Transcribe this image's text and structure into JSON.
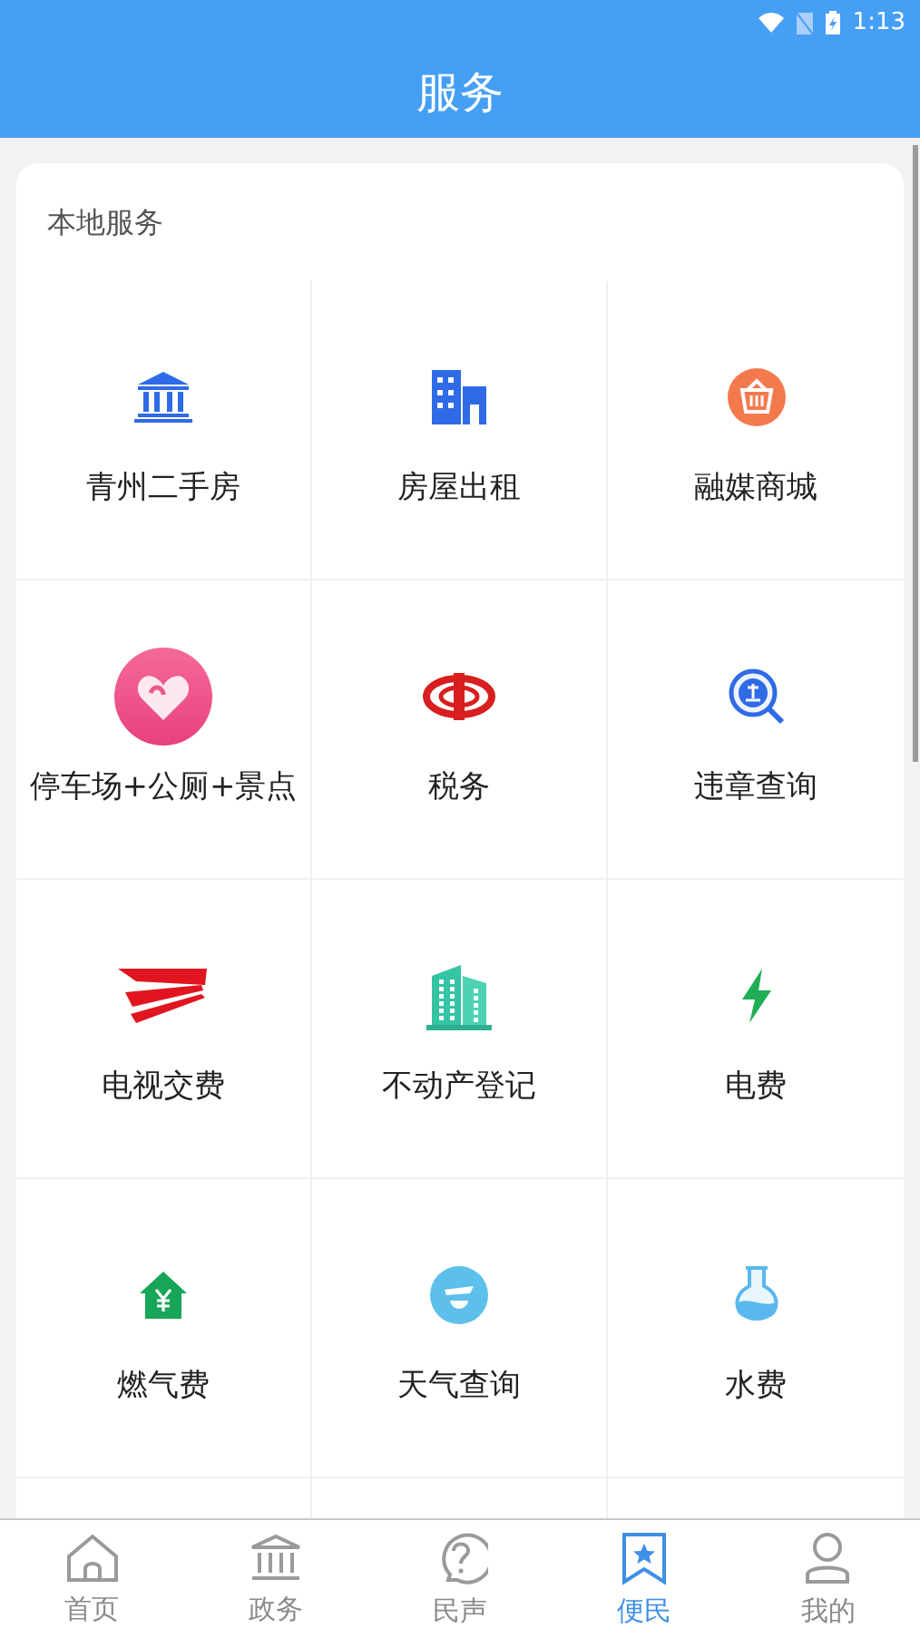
{
  "status_bar": {
    "time": "1:13"
  },
  "header": {
    "title": "服务"
  },
  "section": {
    "title": "本地服务",
    "items": [
      {
        "label": "青州二手房"
      },
      {
        "label": "房屋出租"
      },
      {
        "label": "融媒商城"
      },
      {
        "label": "停车场+公厕+景点"
      },
      {
        "label": "税务"
      },
      {
        "label": "违章查询"
      },
      {
        "label": "电视交费"
      },
      {
        "label": "不动产登记"
      },
      {
        "label": "电费"
      },
      {
        "label": "燃气费"
      },
      {
        "label": "天气查询"
      },
      {
        "label": "水费"
      }
    ]
  },
  "tab_bar": [
    {
      "label": "首页",
      "selected": false
    },
    {
      "label": "政务",
      "selected": false
    },
    {
      "label": "民声",
      "selected": false
    },
    {
      "label": "便民",
      "selected": true
    },
    {
      "label": "我的",
      "selected": false
    }
  ]
}
